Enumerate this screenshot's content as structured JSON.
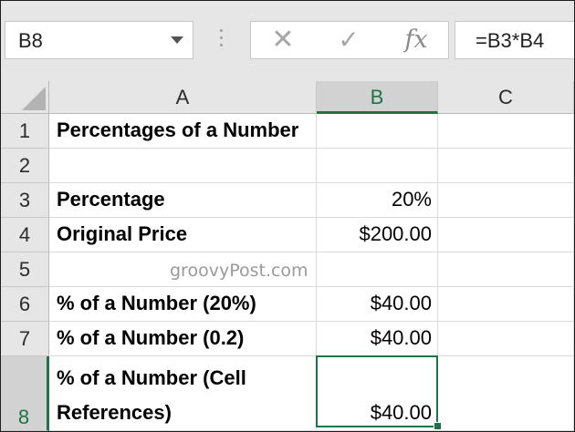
{
  "name_box": {
    "value": "B8"
  },
  "formula_bar": {
    "cancel_icon": "cancel-x-icon",
    "enter_icon": "checkmark-icon",
    "fx_label": "fx",
    "formula": "=B3*B4"
  },
  "columns": [
    "A",
    "B",
    "C"
  ],
  "selected_column": "B",
  "selected_row": "8",
  "rows": [
    {
      "num": "1",
      "a": "Percentages of a Number",
      "b": ""
    },
    {
      "num": "2",
      "a": "",
      "b": ""
    },
    {
      "num": "3",
      "a": "Percentage",
      "b": "20%"
    },
    {
      "num": "4",
      "a": "Original Price",
      "b": "$200.00"
    },
    {
      "num": "5",
      "a": "",
      "b": ""
    },
    {
      "num": "6",
      "a": "% of a Number (20%)",
      "b": "$40.00"
    },
    {
      "num": "7",
      "a": "% of a Number (0.2)",
      "b": "$40.00"
    },
    {
      "num": "8",
      "a": "% of a Number (Cell References)",
      "b": "$40.00"
    }
  ],
  "watermark": "groovyPost.com",
  "colors": {
    "accent": "#217346",
    "header_bg": "#e6e6e6",
    "selected_header_bg": "#d2d2d2"
  }
}
